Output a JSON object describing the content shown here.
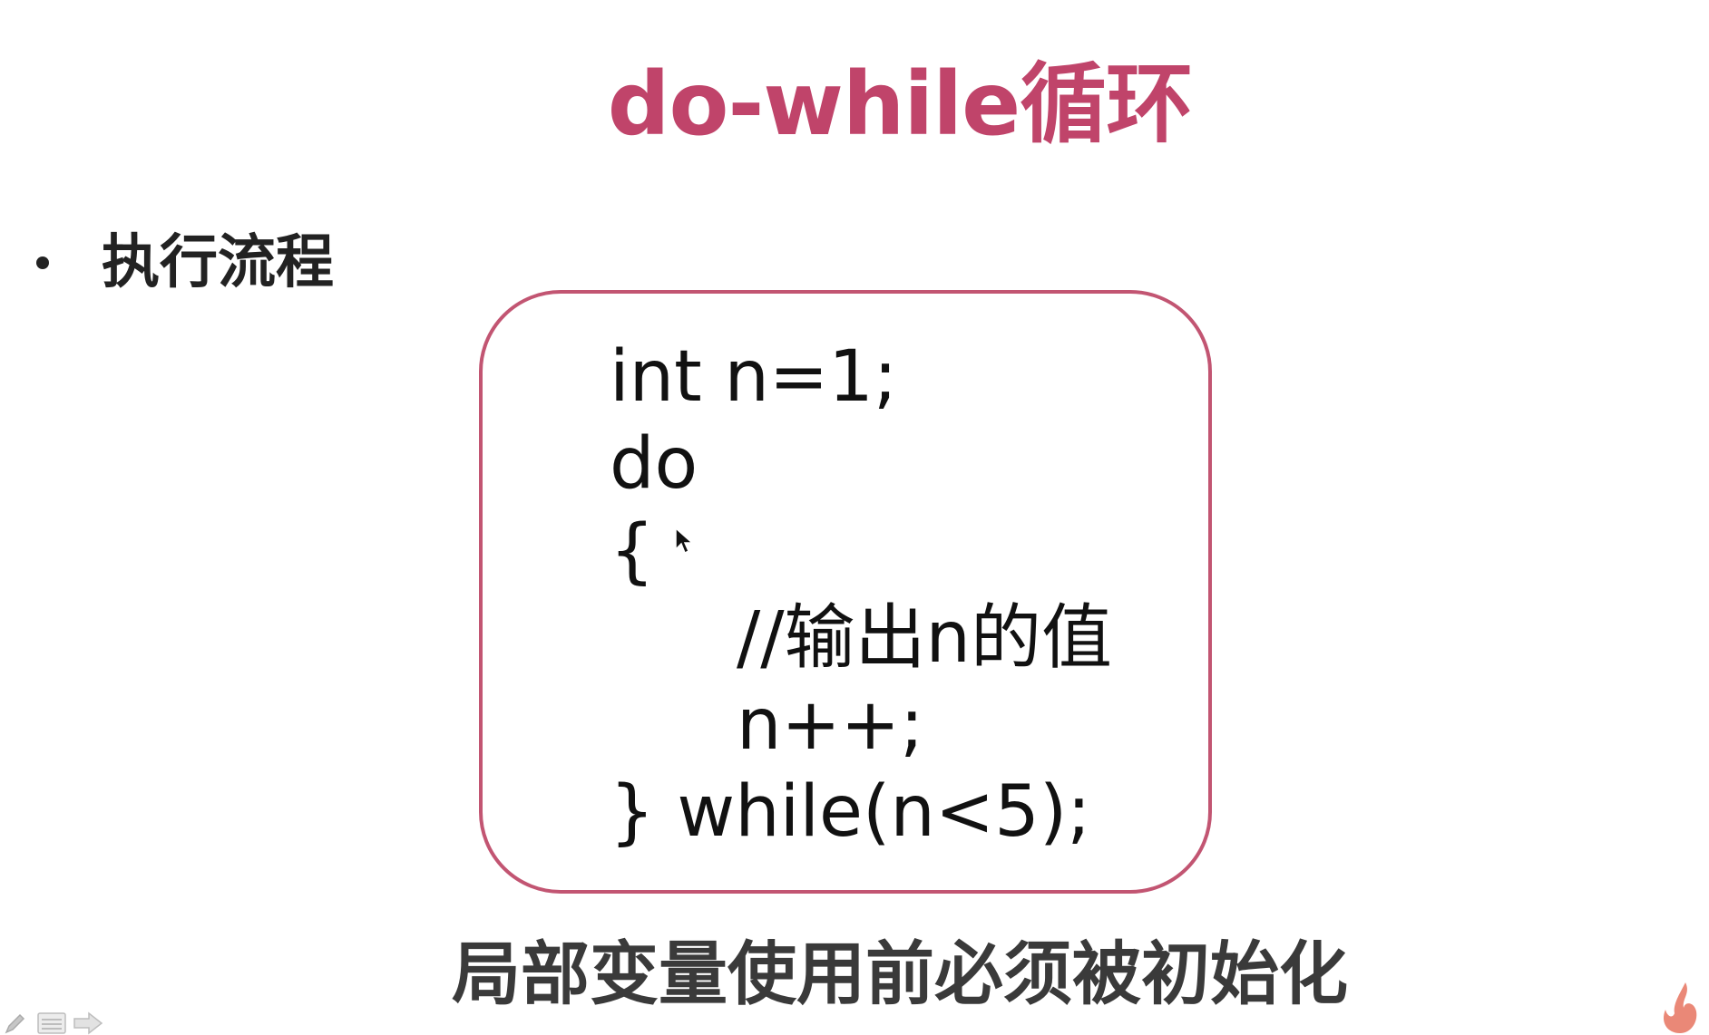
{
  "slide": {
    "title": "do-while循环",
    "bullet": "执行流程",
    "code_lines": [
      "int n=1;",
      "do",
      "{",
      "//输出n的值",
      "n++;",
      "} while(n<5);"
    ],
    "note": "局部变量使用前必须被初始化"
  },
  "colors": {
    "title": "#c0446a",
    "box_border": "#c25572",
    "text": "#111111"
  },
  "icons": {
    "cursor": "mouse-pointer-icon",
    "nav": [
      "pen-icon",
      "menu-icon",
      "next-arrow-icon"
    ],
    "logo": "flame-logo-icon"
  }
}
